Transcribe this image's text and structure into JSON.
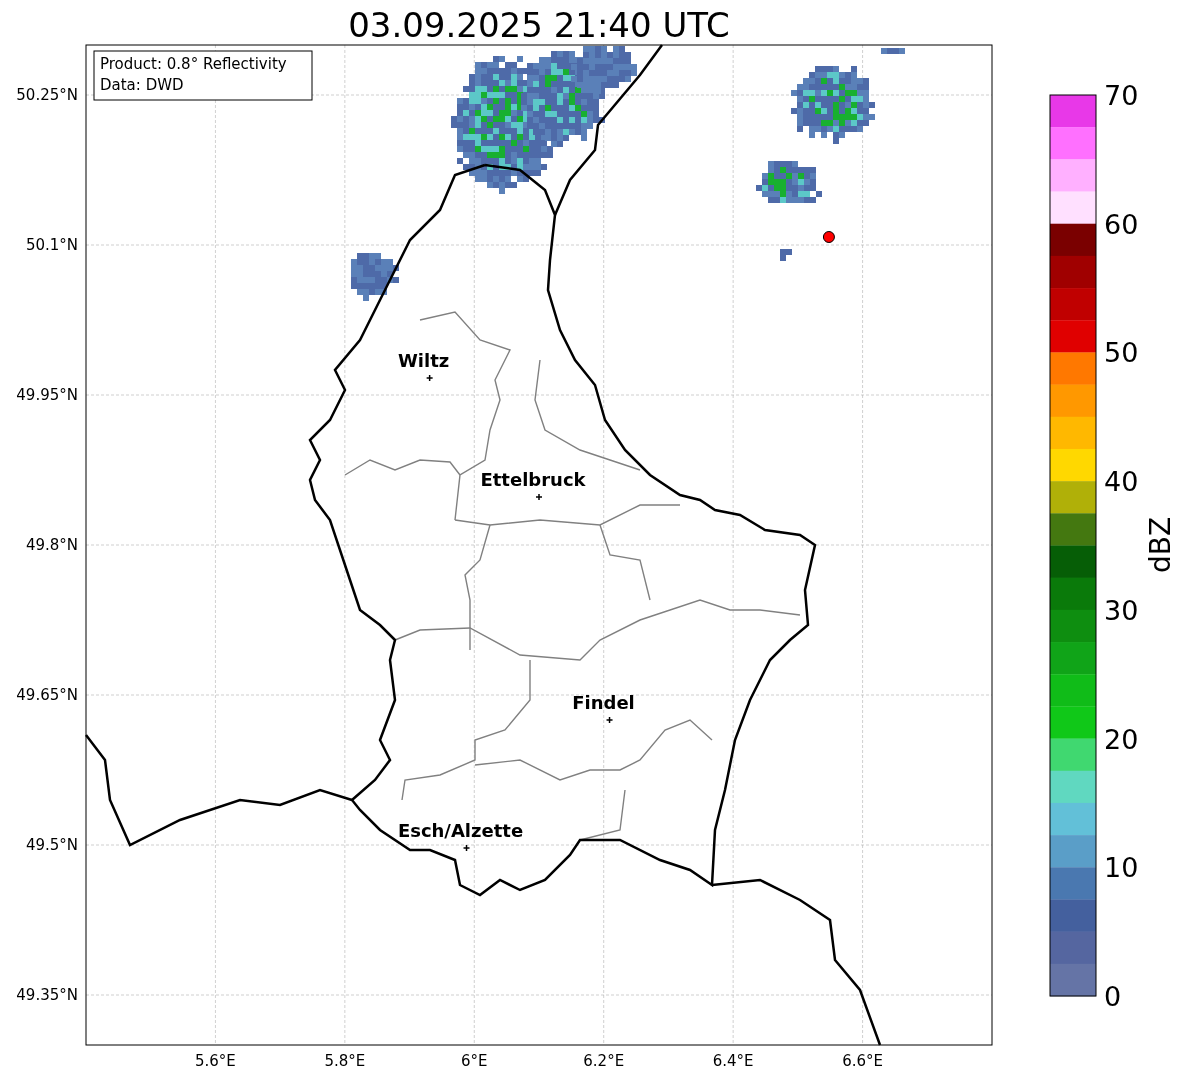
{
  "chart_data": {
    "type": "scatter",
    "title": "03.09.2025 21:40 UTC",
    "x": [
      5.931,
      6.1,
      6.209,
      5.988,
      6.548
    ],
    "series": [
      {
        "color": "#000000",
        "values": [
          49.967,
          49.848,
          49.625,
          49.497,
          null
        ]
      },
      {
        "color": "#ff0000",
        "values": [
          null,
          null,
          null,
          null,
          50.108
        ]
      }
    ],
    "grid": true,
    "xlim": [
      5.4,
      6.8
    ],
    "ylim": [
      49.3,
      50.3
    ],
    "xticks": [
      {
        "value": 5.6,
        "label": "5.6°E"
      },
      {
        "value": 5.8,
        "label": "5.8°E"
      },
      {
        "value": 6.0,
        "label": "6°E"
      },
      {
        "value": 6.2,
        "label": "6.2°E"
      },
      {
        "value": 6.4,
        "label": "6.4°E"
      },
      {
        "value": 6.6,
        "label": "6.6°E"
      }
    ],
    "yticks": [
      {
        "value": 50.25,
        "label": "50.25°N"
      },
      {
        "value": 50.1,
        "label": "50.1°N"
      },
      {
        "value": 49.95,
        "label": "49.95°N"
      },
      {
        "value": 49.8,
        "label": "49.8°N"
      },
      {
        "value": 49.65,
        "label": "49.65°N"
      },
      {
        "value": 49.5,
        "label": "49.5°N"
      },
      {
        "value": 49.35,
        "label": "49.35°N"
      }
    ],
    "annotations": [
      {
        "text": "Wiltz",
        "x": 5.931,
        "y": 49.967
      },
      {
        "text": "Ettelbruck",
        "x": 6.1,
        "y": 49.848
      },
      {
        "text": "Findel",
        "x": 6.209,
        "y": 49.625
      },
      {
        "text": "Esch/Alzette",
        "x": 5.988,
        "y": 49.497
      }
    ]
  },
  "info_box": [
    "Product: 0.8° Reflectivity",
    "Data: DWD"
  ],
  "colorbar": {
    "label": "dBZ",
    "ticks": [
      "70",
      "60",
      "50",
      "40",
      "30",
      "20",
      "10",
      "0"
    ],
    "segments": [
      {
        "color": "#e838e8"
      },
      {
        "color": "#ff70ff"
      },
      {
        "color": "#ffb0ff"
      },
      {
        "color": "#ffe0ff"
      },
      {
        "color": "#7a0000"
      },
      {
        "color": "#a00000"
      },
      {
        "color": "#c00000"
      },
      {
        "color": "#e00000"
      },
      {
        "color": "#ff7800"
      },
      {
        "color": "#ff9800"
      },
      {
        "color": "#ffb800"
      },
      {
        "color": "#ffd800"
      },
      {
        "color": "#b0b008"
      },
      {
        "color": "#447810"
      },
      {
        "color": "#065e06"
      },
      {
        "color": "#0a7a0a"
      },
      {
        "color": "#0e8e10"
      },
      {
        "color": "#10a418"
      },
      {
        "color": "#10bc18"
      },
      {
        "color": "#10c818"
      },
      {
        "color": "#40d870"
      },
      {
        "color": "#60d8c0"
      },
      {
        "color": "#62c0d8"
      },
      {
        "color": "#5a9ec8"
      },
      {
        "color": "#4a78b0"
      },
      {
        "color": "#44609e"
      },
      {
        "color": "#5566a0"
      },
      {
        "color": "#6574a6"
      }
    ]
  }
}
